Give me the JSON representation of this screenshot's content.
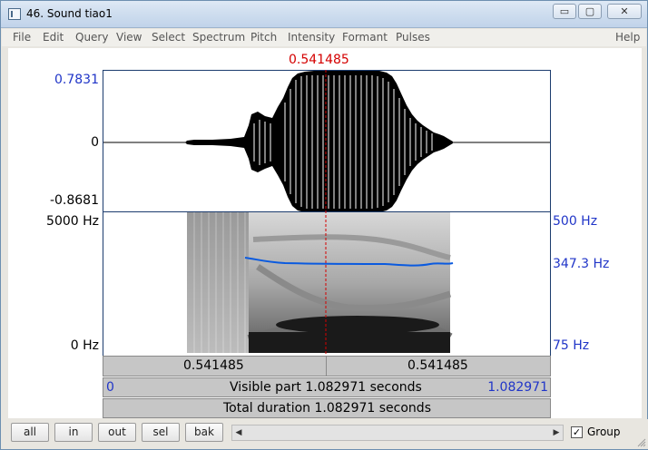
{
  "window": {
    "title": "46. Sound tiao1",
    "minimize": "▭",
    "maximize": "▢",
    "close": "✕"
  },
  "menu": [
    "File",
    "Edit",
    "Query",
    "View",
    "Select",
    "Spectrum",
    "Pitch",
    "Intensity",
    "Formant",
    "Pulses",
    "Help"
  ],
  "cursor": {
    "time_label": "0.541485",
    "time_s": 0.541485
  },
  "waveform": {
    "y_max": "0.7831",
    "y_zero": "0",
    "y_min": "-0.8681"
  },
  "spectrogram": {
    "freq_top": "5000 Hz",
    "freq_bottom": "0 Hz"
  },
  "pitch": {
    "top": "500 Hz",
    "value": "347.3 Hz",
    "bottom": "75 Hz"
  },
  "bars": {
    "left_time": "0.541485",
    "right_time": "0.541485",
    "visible_start": "0",
    "visible_label": "Visible part 1.082971 seconds",
    "visible_end": "1.082971",
    "total_label": "Total duration 1.082971 seconds"
  },
  "buttons": {
    "all": "all",
    "in": "in",
    "out": "out",
    "sel": "sel",
    "bak": "bak"
  },
  "scroll": {
    "left_arrow": "◀",
    "right_arrow": "▶"
  },
  "group": {
    "label": "Group",
    "checked": true,
    "check_mark": "✓"
  },
  "colors": {
    "cursor": "#d40000",
    "axis_text_blue": "#2035c8",
    "pitch_curve": "#0a5adf"
  }
}
